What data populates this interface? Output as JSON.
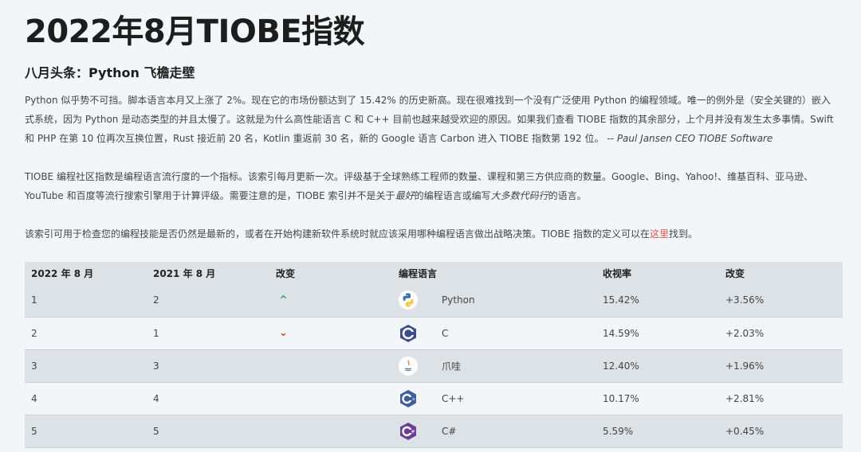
{
  "title": "2022年8月TIOBE指数",
  "headline": "八月头条：Python 飞檐走壁",
  "paragraph1": {
    "text": "Python 似乎势不可挡。脚本语言本月又上涨了 2%。现在它的市场份额达到了 15.42% 的历史新高。现在很难找到一个没有广泛使用 Python 的编程领域。唯一的例外是（安全关键的）嵌入式系统，因为 Python 是动态类型的并且太慢了。这就是为什么高性能语言 C 和 C++ 目前也越来越受欢迎的原因。如果我们查看 TIOBE 指数的其余部分，上个月并没有发生太多事情。Swift 和 PHP 在第 10 位再次互换位置，Rust 接近前 20 名，Kotlin 重返前 30 名，新的 Google 语言 Carbon 进入 TIOBE 指数第 192 位。",
    "quote": "-- Paul Jansen CEO TIOBE Software"
  },
  "paragraph2": {
    "part1": "TIOBE 编程社区指数是编程语言流行度的一个指标。该索引每月更新一次。评级基于全球熟练工程师的数量、课程和第三方供应商的数量。Google、Bing、Yahoo!、维基百科、亚马逊、YouTube 和百度等流行搜索引擎用于计算评级。需要注意的是，TIOBE 索引并不是关于",
    "em1": "最好",
    "part2": "的编程语言或编写",
    "em2": "大多数代码行",
    "part3": "的语言。"
  },
  "paragraph3": {
    "text": "该索引可用于检查您的编程技能是否仍然是最新的，或者在开始构建新软件系统时就应该采用哪种编程语言做出战略决策。TIOBE 指数的定义可以在",
    "link": "这里",
    "tail": "找到。"
  },
  "table": {
    "headers": [
      "2022 年 8 月",
      "2021 年 8 月",
      "改变",
      "编程语言",
      "收视率",
      "改变"
    ],
    "rows": [
      {
        "rank2022": "1",
        "rank2021": "2",
        "trend": "up",
        "trend_glyph": "^",
        "language": "Python",
        "icon": "python-icon",
        "rating": "15.42%",
        "change": "+3.56%"
      },
      {
        "rank2022": "2",
        "rank2021": "1",
        "trend": "down",
        "trend_glyph": "⌄",
        "language": "C",
        "icon": "c-icon",
        "rating": "14.59%",
        "change": "+2.03%"
      },
      {
        "rank2022": "3",
        "rank2021": "3",
        "trend": "none",
        "trend_glyph": "",
        "language": "爪哇",
        "icon": "java-icon",
        "rating": "12.40%",
        "change": "+1.96%"
      },
      {
        "rank2022": "4",
        "rank2021": "4",
        "trend": "none",
        "trend_glyph": "",
        "language": "C++",
        "icon": "cpp-icon",
        "rating": "10.17%",
        "change": "+2.81%"
      },
      {
        "rank2022": "5",
        "rank2021": "5",
        "trend": "none",
        "trend_glyph": "",
        "language": "C#",
        "icon": "csharp-icon",
        "rating": "5.59%",
        "change": "+0.45%"
      }
    ]
  },
  "colors": {
    "background": "#f3f6f8",
    "row_alt": "#dde2e6",
    "link": "#d9534f",
    "up": "#3aa56b",
    "down": "#d63a1a"
  }
}
